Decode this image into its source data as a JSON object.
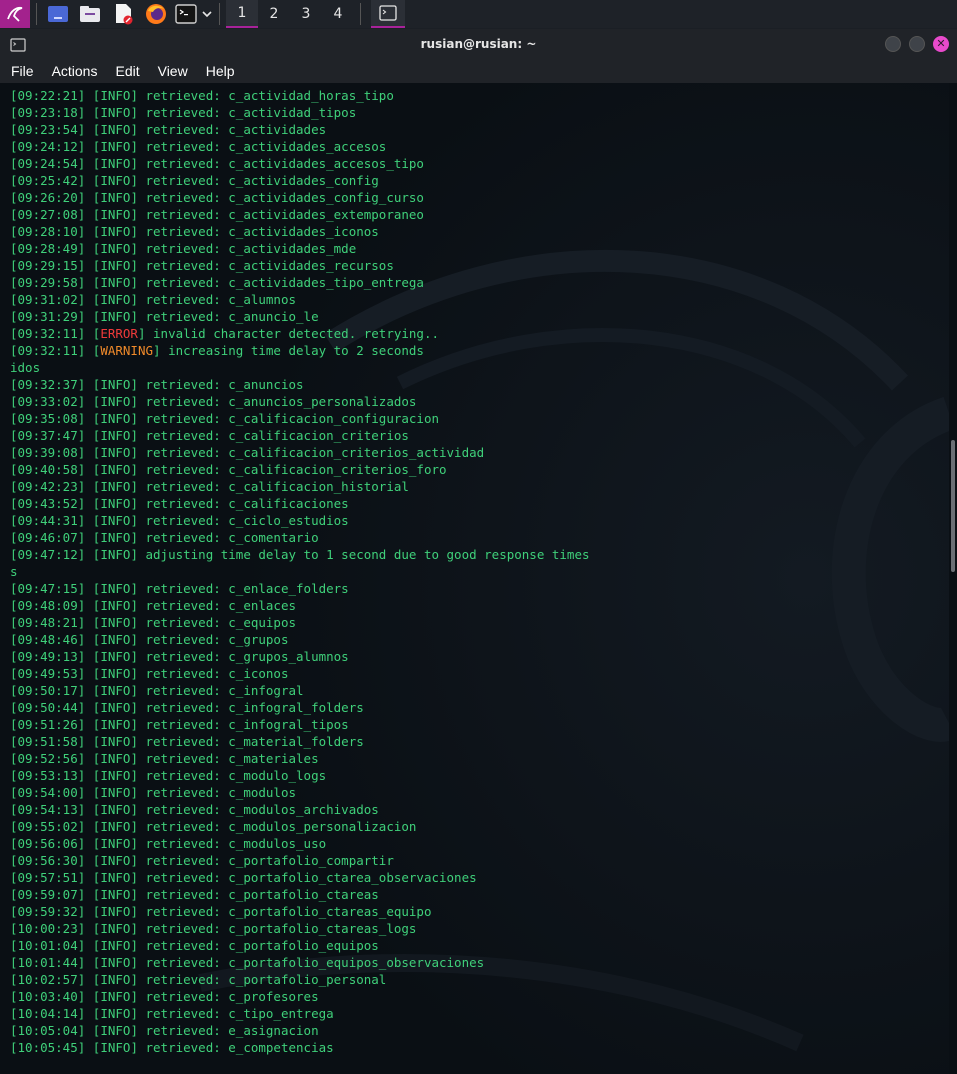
{
  "panel": {
    "workspaces": [
      "1",
      "2",
      "3",
      "4"
    ],
    "active_workspace": "1",
    "icons": [
      "kali-menu-icon",
      "desktop-icon",
      "file-manager-icon",
      "text-editor-icon",
      "firefox-icon",
      "terminal-launcher-icon",
      "dropdown-chevron-icon"
    ]
  },
  "window": {
    "title": "rusian@rusian: ~",
    "menu": [
      "File",
      "Actions",
      "Edit",
      "View",
      "Help"
    ]
  },
  "colors": {
    "accent": "#a3228d",
    "terminal_text": "#3fd07a",
    "error": "#ef3a3a",
    "warning": "#f08a2a"
  },
  "terminal": {
    "lines": [
      {
        "ts": "09:22:21",
        "level": "INFO",
        "msg": "retrieved: c_actividad_horas_tipo"
      },
      {
        "ts": "09:23:18",
        "level": "INFO",
        "msg": "retrieved: c_actividad_tipos"
      },
      {
        "ts": "09:23:54",
        "level": "INFO",
        "msg": "retrieved: c_actividades"
      },
      {
        "ts": "09:24:12",
        "level": "INFO",
        "msg": "retrieved: c_actividades_accesos"
      },
      {
        "ts": "09:24:54",
        "level": "INFO",
        "msg": "retrieved: c_actividades_accesos_tipo"
      },
      {
        "ts": "09:25:42",
        "level": "INFO",
        "msg": "retrieved: c_actividades_config"
      },
      {
        "ts": "09:26:20",
        "level": "INFO",
        "msg": "retrieved: c_actividades_config_curso"
      },
      {
        "ts": "09:27:08",
        "level": "INFO",
        "msg": "retrieved: c_actividades_extemporaneo"
      },
      {
        "ts": "09:28:10",
        "level": "INFO",
        "msg": "retrieved: c_actividades_iconos"
      },
      {
        "ts": "09:28:49",
        "level": "INFO",
        "msg": "retrieved: c_actividades_mde"
      },
      {
        "ts": "09:29:15",
        "level": "INFO",
        "msg": "retrieved: c_actividades_recursos"
      },
      {
        "ts": "09:29:58",
        "level": "INFO",
        "msg": "retrieved: c_actividades_tipo_entrega"
      },
      {
        "ts": "09:31:02",
        "level": "INFO",
        "msg": "retrieved: c_alumnos"
      },
      {
        "ts": "09:31:29",
        "level": "INFO",
        "msg": "retrieved: c_anuncio_le"
      },
      {
        "ts": "09:32:11",
        "level": "ERROR",
        "msg": "invalid character detected. retrying.."
      },
      {
        "ts": "09:32:11",
        "level": "WARNING",
        "msg": "increasing time delay to 2 seconds"
      },
      {
        "raw": "idos"
      },
      {
        "ts": "09:32:37",
        "level": "INFO",
        "msg": "retrieved: c_anuncios"
      },
      {
        "ts": "09:33:02",
        "level": "INFO",
        "msg": "retrieved: c_anuncios_personalizados"
      },
      {
        "ts": "09:35:08",
        "level": "INFO",
        "msg": "retrieved: c_calificacion_configuracion"
      },
      {
        "ts": "09:37:47",
        "level": "INFO",
        "msg": "retrieved: c_calificacion_criterios"
      },
      {
        "ts": "09:39:08",
        "level": "INFO",
        "msg": "retrieved: c_calificacion_criterios_actividad"
      },
      {
        "ts": "09:40:58",
        "level": "INFO",
        "msg": "retrieved: c_calificacion_criterios_foro"
      },
      {
        "ts": "09:42:23",
        "level": "INFO",
        "msg": "retrieved: c_calificacion_historial"
      },
      {
        "ts": "09:43:52",
        "level": "INFO",
        "msg": "retrieved: c_calificaciones"
      },
      {
        "ts": "09:44:31",
        "level": "INFO",
        "msg": "retrieved: c_ciclo_estudios"
      },
      {
        "ts": "09:46:07",
        "level": "INFO",
        "msg": "retrieved: c_comentario"
      },
      {
        "ts": "09:47:12",
        "level": "INFO",
        "msg": "adjusting time delay to 1 second due to good response times"
      },
      {
        "raw": "s"
      },
      {
        "ts": "09:47:15",
        "level": "INFO",
        "msg": "retrieved: c_enlace_folders"
      },
      {
        "ts": "09:48:09",
        "level": "INFO",
        "msg": "retrieved: c_enlaces"
      },
      {
        "ts": "09:48:21",
        "level": "INFO",
        "msg": "retrieved: c_equipos"
      },
      {
        "ts": "09:48:46",
        "level": "INFO",
        "msg": "retrieved: c_grupos"
      },
      {
        "ts": "09:49:13",
        "level": "INFO",
        "msg": "retrieved: c_grupos_alumnos"
      },
      {
        "ts": "09:49:53",
        "level": "INFO",
        "msg": "retrieved: c_iconos"
      },
      {
        "ts": "09:50:17",
        "level": "INFO",
        "msg": "retrieved: c_infogral"
      },
      {
        "ts": "09:50:44",
        "level": "INFO",
        "msg": "retrieved: c_infogral_folders"
      },
      {
        "ts": "09:51:26",
        "level": "INFO",
        "msg": "retrieved: c_infogral_tipos"
      },
      {
        "ts": "09:51:58",
        "level": "INFO",
        "msg": "retrieved: c_material_folders"
      },
      {
        "ts": "09:52:56",
        "level": "INFO",
        "msg": "retrieved: c_materiales"
      },
      {
        "ts": "09:53:13",
        "level": "INFO",
        "msg": "retrieved: c_modulo_logs"
      },
      {
        "ts": "09:54:00",
        "level": "INFO",
        "msg": "retrieved: c_modulos"
      },
      {
        "ts": "09:54:13",
        "level": "INFO",
        "msg": "retrieved: c_modulos_archivados"
      },
      {
        "ts": "09:55:02",
        "level": "INFO",
        "msg": "retrieved: c_modulos_personalizacion"
      },
      {
        "ts": "09:56:06",
        "level": "INFO",
        "msg": "retrieved: c_modulos_uso"
      },
      {
        "ts": "09:56:30",
        "level": "INFO",
        "msg": "retrieved: c_portafolio_compartir"
      },
      {
        "ts": "09:57:51",
        "level": "INFO",
        "msg": "retrieved: c_portafolio_ctarea_observaciones"
      },
      {
        "ts": "09:59:07",
        "level": "INFO",
        "msg": "retrieved: c_portafolio_ctareas"
      },
      {
        "ts": "09:59:32",
        "level": "INFO",
        "msg": "retrieved: c_portafolio_ctareas_equipo"
      },
      {
        "ts": "10:00:23",
        "level": "INFO",
        "msg": "retrieved: c_portafolio_ctareas_logs"
      },
      {
        "ts": "10:01:04",
        "level": "INFO",
        "msg": "retrieved: c_portafolio_equipos"
      },
      {
        "ts": "10:01:44",
        "level": "INFO",
        "msg": "retrieved: c_portafolio_equipos_observaciones"
      },
      {
        "ts": "10:02:57",
        "level": "INFO",
        "msg": "retrieved: c_portafolio_personal"
      },
      {
        "ts": "10:03:40",
        "level": "INFO",
        "msg": "retrieved: c_profesores"
      },
      {
        "ts": "10:04:14",
        "level": "INFO",
        "msg": "retrieved: c_tipo_entrega"
      },
      {
        "ts": "10:05:04",
        "level": "INFO",
        "msg": "retrieved: e_asignacion"
      },
      {
        "ts": "10:05:45",
        "level": "INFO",
        "msg": "retrieved: e_competencias"
      }
    ]
  }
}
